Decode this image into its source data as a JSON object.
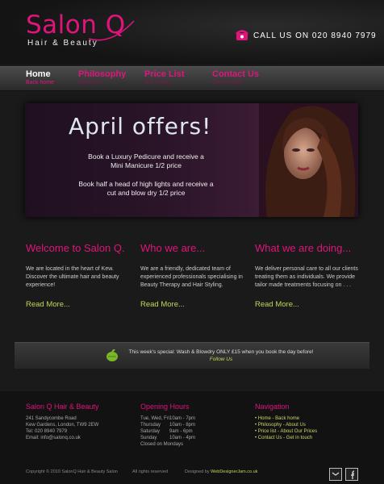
{
  "brand": {
    "name": "Salon",
    "letter": "Q",
    "tagline": "Hair & Beauty",
    "accent": "#e0147d"
  },
  "header": {
    "phone_text": "CALL US ON 020 8940 7979"
  },
  "nav": [
    {
      "title": "Home",
      "sub": "Back home"
    },
    {
      "title": "Philosophy",
      "sub": "About Us"
    },
    {
      "title": "Price List",
      "sub": "Our Prices"
    },
    {
      "title": "Contact Us",
      "sub": "Get in touch"
    }
  ],
  "hero": {
    "title": "April offers!",
    "line1": "Book a Luxury Pedicure and receive a",
    "line2": "Mini Manicure 1/2 price",
    "line3": "Book half a head of high lights and receive a",
    "line4": "cut and blow dry 1/2 price"
  },
  "columns": [
    {
      "title": "Welcome to Salon Q.",
      "text": "We are located in the heart of Kew. Discover the ultimate hair and beauty experience!",
      "more": "Read More..."
    },
    {
      "title": "Who we are...",
      "text": "We are a friendly, dedicated team of experienced professionals specialising in Beauty Therapy and Hair Styling.",
      "more": "Read More..."
    },
    {
      "title": "What we are doing...",
      "text": "We deliver personal care to all our clients treating them as individuals. We provide tailor made treatments focusing on . . .",
      "more": "Read More..."
    }
  ],
  "special": {
    "text": "This week's special: Wash & Blowdry ONLY £15 when you book the day before!",
    "link": "Follow Us"
  },
  "footer": {
    "contact": {
      "title": "Salon Q Hair & Beauty",
      "lines": [
        "241 Sandycombe Road",
        "Kew Gardens, London, TW9 2EW",
        "Tel: 020 8940 7979",
        "Email: info@salonq.co.uk"
      ]
    },
    "hours": {
      "title": "Opening Hours",
      "rows": [
        {
          "day": "Tue, Wed, Fri",
          "time": "10am - 7pm"
        },
        {
          "day": "Thursday",
          "time": "10am - 8pm"
        },
        {
          "day": "Saturday",
          "time": "9am - 6pm"
        },
        {
          "day": "Sunday",
          "time": "10am - 4pm"
        }
      ],
      "closed": "Closed on Mondays"
    },
    "navigation": {
      "title": "Navigation",
      "links": [
        "Home - Back home",
        "Philosophy - About Us",
        "Price list - About Our Prices",
        "Contact Us - Get in touch"
      ]
    }
  },
  "bottom": {
    "copyright": "Copyright © 2010 SalonQ Hair & Beauty Salon",
    "rights": "All rights reserved",
    "designed_label": "Designed by",
    "designer": "WebDesignerJam.co.uk"
  }
}
